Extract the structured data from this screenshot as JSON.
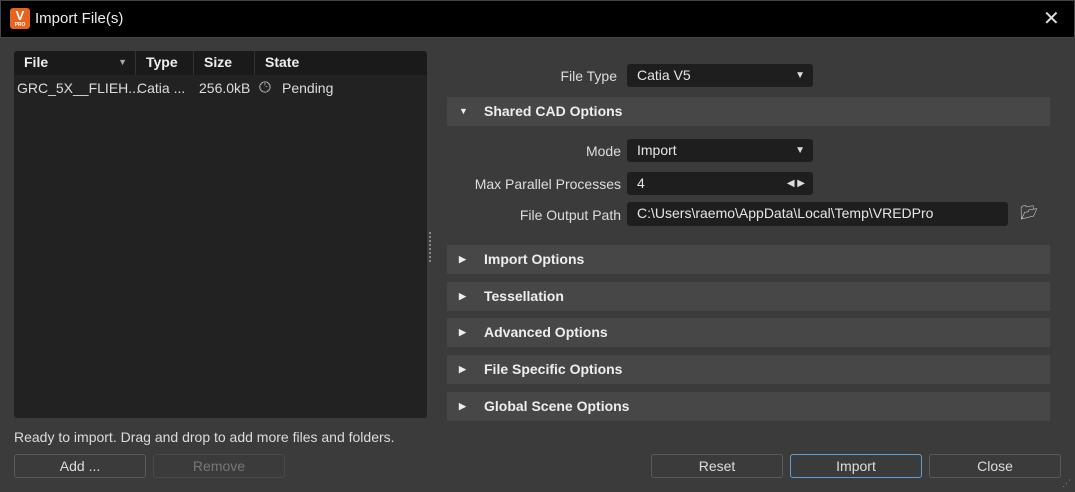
{
  "window": {
    "title": "Import File(s)",
    "logo_text": "V",
    "logo_sub": "PRO"
  },
  "file_list": {
    "columns": [
      "File",
      "Type",
      "Size",
      "State"
    ],
    "rows": [
      {
        "file": "GRC_5X__FLIEH...",
        "type": "Catia ...",
        "size": "256.0kB",
        "state": "Pending"
      }
    ]
  },
  "options": {
    "file_type_label": "File Type",
    "file_type_value": "Catia V5",
    "shared_section": "Shared CAD Options",
    "mode_label": "Mode",
    "mode_value": "Import",
    "max_label": "Max Parallel Processes",
    "max_value": "4",
    "path_label": "File Output Path",
    "path_value": "C:\\Users\\raemo\\AppData\\Local\\Temp\\VREDPro",
    "sections": [
      "Import Options",
      "Tessellation",
      "Advanced Options",
      "File Specific Options",
      "Global Scene Options"
    ]
  },
  "status": "Ready to import. Drag and drop to add more files and folders.",
  "buttons": {
    "add": "Add ...",
    "remove": "Remove",
    "reset": "Reset",
    "import": "Import",
    "close": "Close"
  }
}
